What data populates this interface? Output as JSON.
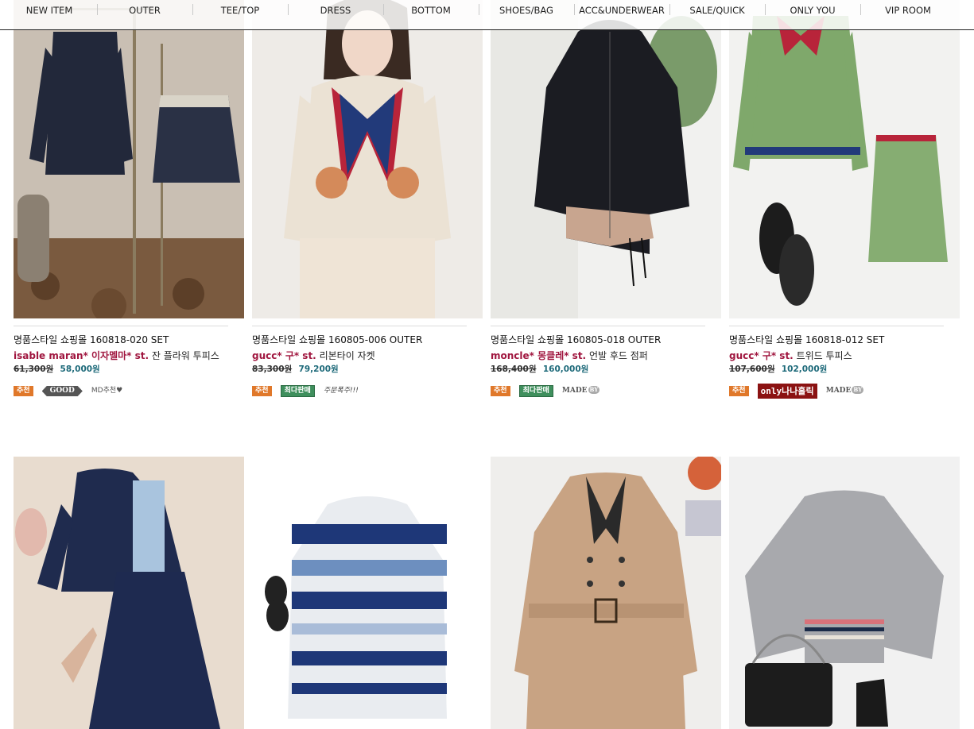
{
  "nav": {
    "items": [
      "NEW ITEM",
      "OUTER",
      "TEE/TOP",
      "DRESS",
      "BOTTOM",
      "SHOES/BAG",
      "ACC&UNDERWEAR",
      "SALE/QUICK",
      "ONLY YOU",
      "VIP ROOM"
    ]
  },
  "products": [
    {
      "name": "명품스타일 쇼핑몰 160818-020 SET",
      "brand": "isable maran* 이자멜마* st.",
      "desc": "잔 플라워 투피스",
      "old_price": "61,300원",
      "price": "58,000원",
      "badges": [
        {
          "type": "rec",
          "label": "추천"
        },
        {
          "type": "good",
          "label": "GOOD"
        },
        {
          "type": "md",
          "label": "MD추천♥"
        }
      ]
    },
    {
      "name": "명품스타일 쇼핑몰 160805-006 OUTER",
      "brand": "gucc* 구* st.",
      "desc": "리본타이 자켓",
      "old_price": "83,300원",
      "price": "79,200원",
      "badges": [
        {
          "type": "rec",
          "label": "추천"
        },
        {
          "type": "best",
          "label": "최다판매"
        },
        {
          "type": "order",
          "label": "주문폭주!!!"
        }
      ]
    },
    {
      "name": "명품스타일 쇼핑몰 160805-018 OUTER",
      "brand": "moncle* 몽클레* st.",
      "desc": "언발 후드 점퍼",
      "old_price": "168,400원",
      "price": "160,000원",
      "badges": [
        {
          "type": "rec",
          "label": "추천"
        },
        {
          "type": "best",
          "label": "최다판매"
        },
        {
          "type": "made",
          "label": "MADE",
          "sub": "BY"
        }
      ]
    },
    {
      "name": "명품스타일 쇼핑몰 160818-012 SET",
      "brand": "gucc* 구* st.",
      "desc": "트위드 투피스",
      "old_price": "107,600원",
      "price": "102,000원",
      "badges": [
        {
          "type": "rec",
          "label": "추천"
        },
        {
          "type": "only",
          "label": "only나나홀릭"
        },
        {
          "type": "made",
          "label": "MADE",
          "sub": "BY"
        }
      ]
    }
  ],
  "colors": {
    "brand_text": "#a0163f",
    "price_text": "#1e6a7a",
    "recommend_badge": "#e0782a",
    "best_badge": "#3f8f5d",
    "only_badge": "#8b1212"
  }
}
